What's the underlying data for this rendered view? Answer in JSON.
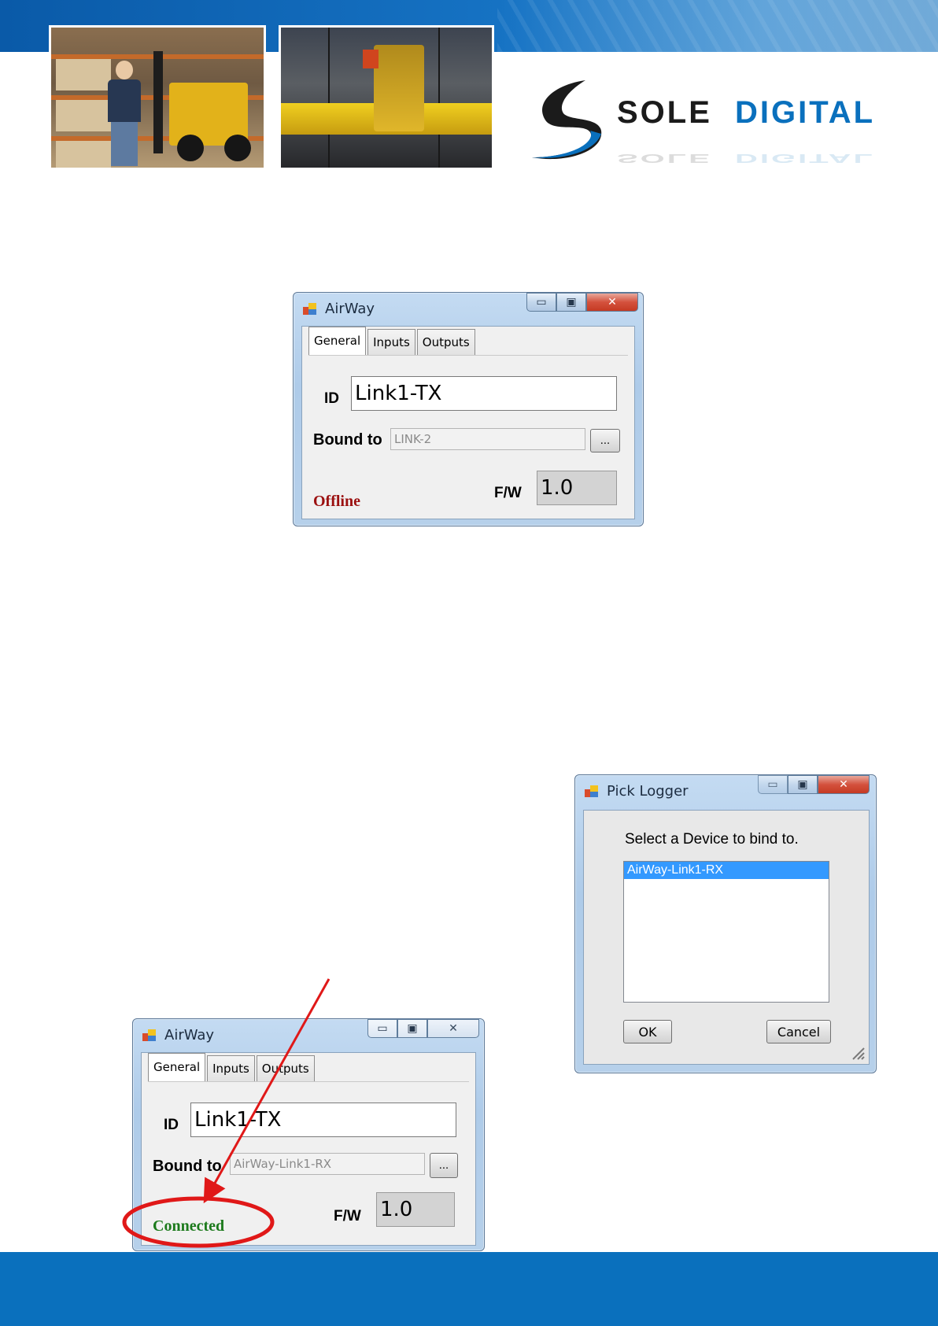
{
  "header": {
    "logo_word1": "SOLE",
    "logo_word2": "DIGITAL"
  },
  "window_offline": {
    "title": "AirWay",
    "tabs": [
      "General",
      "Inputs",
      "Outputs"
    ],
    "id_label": "ID",
    "id_value": "Link1-TX",
    "bound_label": "Bound to",
    "bound_value": "LINK-2",
    "browse_label": "...",
    "status": "Offline",
    "fw_label": "F/W",
    "fw_value": "1.0"
  },
  "pick_logger": {
    "title": "Pick Logger",
    "prompt": "Select a Device to bind to.",
    "items": [
      "AirWay-Link1-RX"
    ],
    "ok_label": "OK",
    "cancel_label": "Cancel"
  },
  "window_connected": {
    "title": "AirWay",
    "tabs": [
      "General",
      "Inputs",
      "Outputs"
    ],
    "id_label": "ID",
    "id_value": "Link1-TX",
    "bound_label": "Bound to",
    "bound_value": "AirWay-Link1-RX",
    "browse_label": "...",
    "status": "Connected",
    "fw_label": "F/W",
    "fw_value": "1.0"
  },
  "colors": {
    "brand_blue": "#0a70bd",
    "status_offline": "#9b1010",
    "status_connected": "#1c7a1c",
    "annotation_red": "#e01818"
  },
  "icons": {
    "app_icon": "app-window-icon",
    "minimize": "minimize-icon",
    "maximize": "maximize-icon",
    "close": "close-icon"
  }
}
